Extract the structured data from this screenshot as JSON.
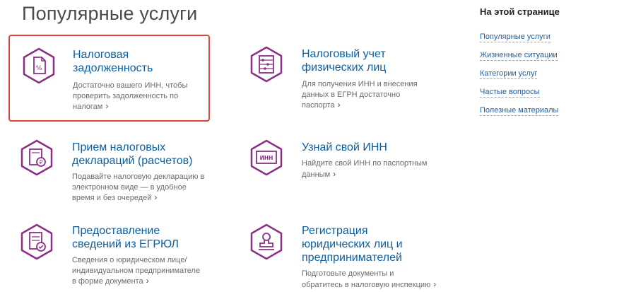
{
  "page_title": "Популярные услуги",
  "sidebar": {
    "title": "На этой странице",
    "links": [
      "Популярные услуги",
      "Жизненные ситуации",
      "Категории услуг",
      "Частые вопросы",
      "Полезные материалы"
    ]
  },
  "services": [
    {
      "title_lines": [
        "Налоговая",
        "задолженность"
      ],
      "desc_lines": [
        "Достаточно вашего ИНН, чтобы",
        "проверить задолженность по",
        "налогам"
      ],
      "icon": "tax-debt-icon"
    },
    {
      "title_lines": [
        "Налоговый учет",
        "физических лиц"
      ],
      "desc_lines": [
        "Для получения ИНН и внесения",
        "данных в ЕГРН достаточно",
        "паспорта"
      ],
      "icon": "abacus-icon"
    },
    {
      "title_lines": [
        "Прием налоговых",
        "деклараций (расчетов)"
      ],
      "desc_lines": [
        "Подавайте налоговую декларацию в",
        "электронном виде — в удобное",
        "время и без очередей"
      ],
      "icon": "ruble-document-icon"
    },
    {
      "title_lines": [
        "Узнай свой ИНН"
      ],
      "desc_lines": [
        "Найдите свой ИНН по паспортным",
        "данным"
      ],
      "icon": "inn-card-icon"
    },
    {
      "title_lines": [
        "Предоставление",
        "сведений из ЕГРЮЛ"
      ],
      "desc_lines": [
        "Сведения о юридическом лице/",
        "индивидуальном предпринимателе",
        "в форме документа"
      ],
      "icon": "document-check-icon"
    },
    {
      "title_lines": [
        "Регистрация",
        "юридических лиц и",
        "предпринимателей"
      ],
      "desc_lines": [
        "Подготовьте документы и",
        "обратитесь в налоговую инспекцию"
      ],
      "icon": "stamp-icon"
    }
  ],
  "colors": {
    "accent": "#8b2f86",
    "link": "#0b5fa5",
    "highlight": "#e3453c"
  }
}
